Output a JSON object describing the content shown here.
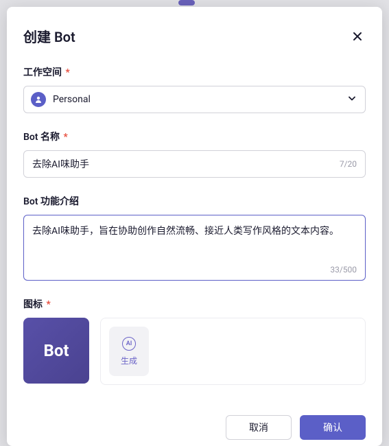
{
  "modal": {
    "title": "创建 Bot"
  },
  "workspace": {
    "label": "工作空间",
    "value": "Personal"
  },
  "botName": {
    "label": "Bot 名称",
    "value": "去除AI味助手",
    "count": "7/20"
  },
  "description": {
    "label": "Bot 功能介绍",
    "value": "去除AI味助手，旨在协助创作自然流畅、接近人类写作风格的文本内容。",
    "count": "33/500"
  },
  "icon": {
    "label": "图标",
    "previewText": "Bot",
    "generateLabel": "生成",
    "aiIconText": "AI"
  },
  "footer": {
    "cancel": "取消",
    "confirm": "确认"
  },
  "requiredMark": "*"
}
